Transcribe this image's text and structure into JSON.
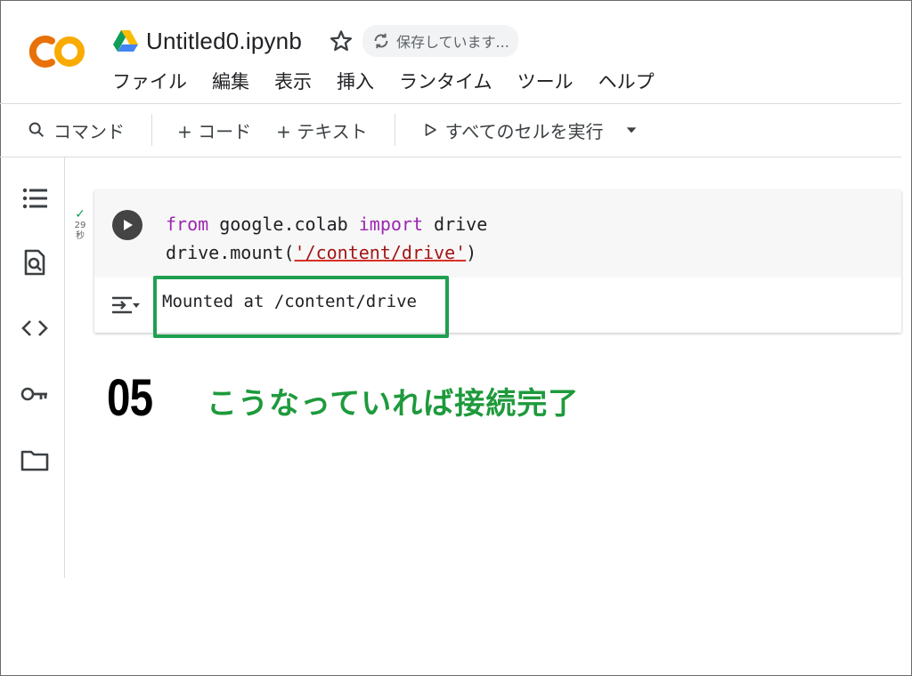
{
  "header": {
    "logo_text": "CO",
    "doc_title": "Untitled0.ipynb",
    "save_status": "保存しています..."
  },
  "menu": [
    "ファイル",
    "編集",
    "表示",
    "挿入",
    "ランタイム",
    "ツール",
    "ヘルプ"
  ],
  "toolbar": {
    "command": "コマンド",
    "add_code": "+ コード",
    "add_text": "+ テキスト",
    "run_all": "すべてのセルを実行"
  },
  "cell": {
    "exec_check": "✓",
    "exec_time": "29",
    "exec_unit": "秒",
    "code_line1": {
      "kw1": "from",
      "mid": " google.colab ",
      "kw2": "import",
      "rest": " drive"
    },
    "code_line2": {
      "pre": "drive.mount(",
      "q1": "'",
      "str": "/content/drive",
      "q2": "'",
      "post": ")"
    },
    "output": "Mounted at /content/drive"
  },
  "annotation": {
    "step": "05",
    "caption": "こうなっていれば接続完了",
    "color": "#1e9a3c",
    "box_color": "#1fa050"
  },
  "colors": {
    "logo_orange": "#f9ab00",
    "logo_dark_orange": "#e8710a",
    "keyword": "#9c27b0",
    "string": "#a31515"
  }
}
